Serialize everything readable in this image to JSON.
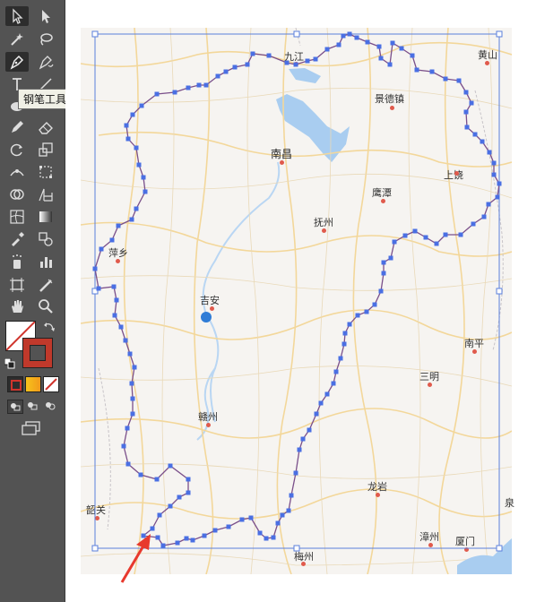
{
  "toolbar": {
    "background": "#535353",
    "tools": [
      {
        "name": "selection-tool",
        "icon": "arrow-icon"
      },
      {
        "name": "direct-selection-tool",
        "icon": "white-arrow-icon"
      },
      {
        "name": "magic-wand-tool",
        "icon": "wand-icon"
      },
      {
        "name": "lasso-tool",
        "icon": "lasso-icon"
      },
      {
        "name": "pen-tool",
        "icon": "pen-icon",
        "active": true
      },
      {
        "name": "curvature-tool",
        "icon": "curvature-icon"
      },
      {
        "name": "type-tool",
        "icon": "type-icon"
      },
      {
        "name": "line-tool",
        "icon": "line-icon"
      },
      {
        "name": "ellipse-tool",
        "icon": "ellipse-icon"
      },
      {
        "name": "pencil-tool",
        "icon": "pencil-icon"
      },
      {
        "name": "eraser-tool",
        "icon": "eraser-icon"
      },
      {
        "name": "rotate-tool",
        "icon": "rotate-icon"
      },
      {
        "name": "scale-tool",
        "icon": "scale-icon"
      },
      {
        "name": "width-tool",
        "icon": "width-icon"
      },
      {
        "name": "free-transform-tool",
        "icon": "free-transform-icon"
      },
      {
        "name": "shape-builder-tool",
        "icon": "shape-builder-icon"
      },
      {
        "name": "perspective-grid-tool",
        "icon": "perspective-icon"
      },
      {
        "name": "mesh-tool",
        "icon": "mesh-icon"
      },
      {
        "name": "gradient-tool",
        "icon": "gradient-icon"
      },
      {
        "name": "eyedropper-tool",
        "icon": "eyedropper-icon"
      },
      {
        "name": "blend-tool",
        "icon": "blend-icon"
      },
      {
        "name": "symbol-sprayer-tool",
        "icon": "spray-icon"
      },
      {
        "name": "column-graph-tool",
        "icon": "graph-icon"
      },
      {
        "name": "artboard-tool",
        "icon": "artboard-icon"
      },
      {
        "name": "slice-tool",
        "icon": "slice-icon"
      },
      {
        "name": "hand-tool",
        "icon": "hand-icon"
      },
      {
        "name": "zoom-tool",
        "icon": "zoom-icon"
      }
    ],
    "tooltip": "钢笔工具 (P)",
    "fill_color": "none",
    "stroke_color": "#c0392b"
  },
  "map": {
    "cities": [
      {
        "name": "九江",
        "big": false
      },
      {
        "name": "黄山",
        "big": false
      },
      {
        "name": "景德镇",
        "big": false
      },
      {
        "name": "南昌",
        "big": true
      },
      {
        "name": "上饶",
        "big": false
      },
      {
        "name": "鹰潭",
        "big": false
      },
      {
        "name": "抚州",
        "big": false
      },
      {
        "name": "萍乡",
        "big": false
      },
      {
        "name": "吉安",
        "big": false
      },
      {
        "name": "南平",
        "big": false
      },
      {
        "name": "三明",
        "big": false
      },
      {
        "name": "赣州",
        "big": false
      },
      {
        "name": "龙岩",
        "big": false
      },
      {
        "name": "韶关",
        "big": false
      },
      {
        "name": "漳州",
        "big": false
      },
      {
        "name": "厦门",
        "big": false
      },
      {
        "name": "梅州",
        "big": false
      },
      {
        "name": "泉",
        "big": false
      }
    ],
    "path_stroke": "#7a4f8a",
    "anchor_color": "#4a6fe3",
    "bbox_color": "#5b7fdc"
  }
}
